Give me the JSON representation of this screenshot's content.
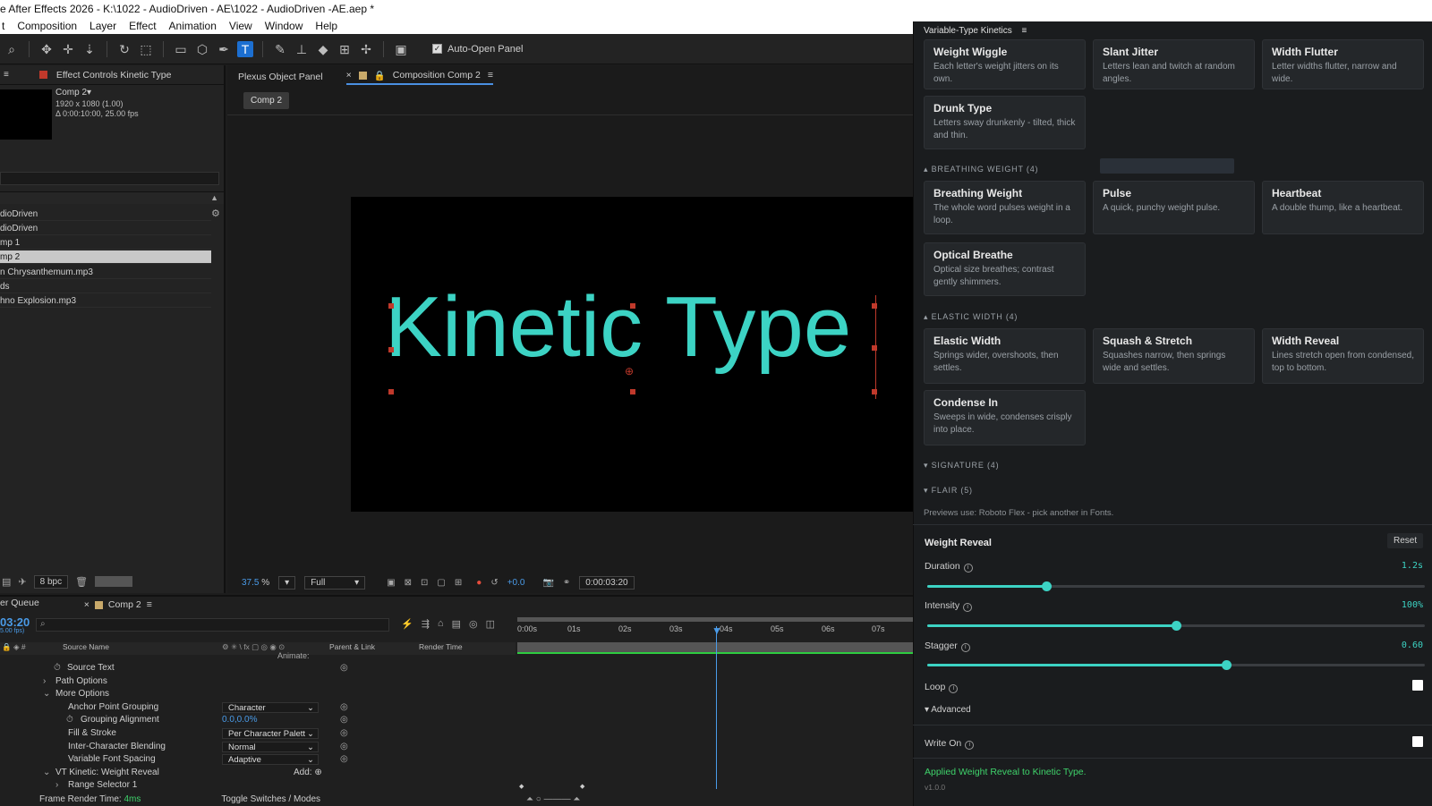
{
  "titlebar": {
    "title": "e After Effects 2026 - K:\\1022 - AudioDriven - AE\\1022 - AudioDriven -AE.aep *"
  },
  "menu": [
    "t",
    "Composition",
    "Layer",
    "Effect",
    "Animation",
    "View",
    "Window",
    "Help"
  ],
  "toolbar": {
    "auto_open": "Auto-Open Panel"
  },
  "left_panel": {
    "tab": "Effect Controls Kinetic Type",
    "comp_name": "Comp 2▾",
    "comp_res": "1920 x 1080 (1.00)",
    "comp_dur": "Δ 0:00:10:00, 25.00 fps",
    "items": [
      "dioDriven",
      "dioDriven",
      "mp 1",
      "mp 2",
      "n Chrysanthemum.mp3",
      "ds",
      "hno Explosion.mp3"
    ],
    "bpc": "8 bpc"
  },
  "viewer": {
    "tab_plexus": "Plexus Object Panel",
    "tab_comp": "Composition Comp 2",
    "comp_btn": "Comp 2",
    "text": "Kinetic Type",
    "zoom": "37.5",
    "zoom_unit": "%",
    "quality": "Full",
    "exposure": "+0.0",
    "time": "0:00:03:20"
  },
  "timeline": {
    "tab_queue": "er Queue",
    "tab_comp": "Comp 2",
    "timecode": "03:20",
    "fps": "5.00 fps)",
    "col_source": "Source Name",
    "col_parent": "Parent & Link",
    "col_render": "Render Time",
    "ruler": [
      "0:00s",
      "01s",
      "02s",
      "03s",
      "04s",
      "05s",
      "06s",
      "07s"
    ],
    "rows": [
      {
        "label": "Source Text"
      },
      {
        "label": "Path Options"
      },
      {
        "label": "More Options"
      },
      {
        "label": "Anchor Point Grouping",
        "value": "Character"
      },
      {
        "label": "Grouping Alignment",
        "value": "0.0,0.0%"
      },
      {
        "label": "Fill & Stroke",
        "value": "Per Character Palett"
      },
      {
        "label": "Inter-Character Blending",
        "value": "Normal"
      },
      {
        "label": "Variable Font Spacing",
        "value": "Adaptive"
      },
      {
        "label": "VT Kinetic: Weight Reveal",
        "value": "Add:"
      },
      {
        "label": "Range Selector 1"
      }
    ],
    "animate": "Animate:",
    "frame_render": "Frame Render Time:",
    "frame_render_val": "4ms",
    "toggle": "Toggle Switches / Modes"
  },
  "vtk": {
    "title": "Variable-Type Kinetics",
    "cards_top": [
      {
        "title": "Weight Wiggle",
        "desc": "Each letter's weight jitters on its own."
      },
      {
        "title": "Slant Jitter",
        "desc": "Letters lean and twitch at random angles."
      },
      {
        "title": "Width Flutter",
        "desc": "Letter widths flutter, narrow and wide."
      },
      {
        "title": "Drunk Type",
        "desc": "Letters sway drunkenly - tilted, thick and thin."
      }
    ],
    "sec_breathing": "BREATHING WEIGHT (4)",
    "cards_breathing": [
      {
        "title": "Breathing Weight",
        "desc": "The whole word pulses weight in a loop."
      },
      {
        "title": "Pulse",
        "desc": "A quick, punchy weight pulse."
      },
      {
        "title": "Heartbeat",
        "desc": "A double thump, like a heartbeat."
      },
      {
        "title": "Optical Breathe",
        "desc": "Optical size breathes; contrast gently shimmers."
      }
    ],
    "sec_elastic": "ELASTIC WIDTH (4)",
    "cards_elastic": [
      {
        "title": "Elastic Width",
        "desc": "Springs wider, overshoots, then settles."
      },
      {
        "title": "Squash & Stretch",
        "desc": "Squashes narrow, then springs wide and settles."
      },
      {
        "title": "Width Reveal",
        "desc": "Lines stretch open from condensed, top to bottom."
      },
      {
        "title": "Condense In",
        "desc": "Sweeps in wide, condenses crisply into place."
      }
    ],
    "sec_signature": "SIGNATURE (4)",
    "sec_flair": "FLAIR (5)",
    "previews": "Previews use: Roboto Flex - pick another in Fonts.",
    "params": {
      "title": "Weight Reveal",
      "reset": "Reset",
      "duration_label": "Duration",
      "duration_val": "1.2s",
      "duration_frac": 0.24,
      "intensity_label": "Intensity",
      "intensity_val": "100%",
      "intensity_frac": 0.5,
      "stagger_label": "Stagger",
      "stagger_val": "0.60",
      "stagger_frac": 0.6,
      "loop_label": "Loop",
      "advanced": "Advanced",
      "writeon_label": "Write On"
    },
    "status": "Applied Weight Reveal to Kinetic Type.",
    "version": "v1.0.0"
  }
}
